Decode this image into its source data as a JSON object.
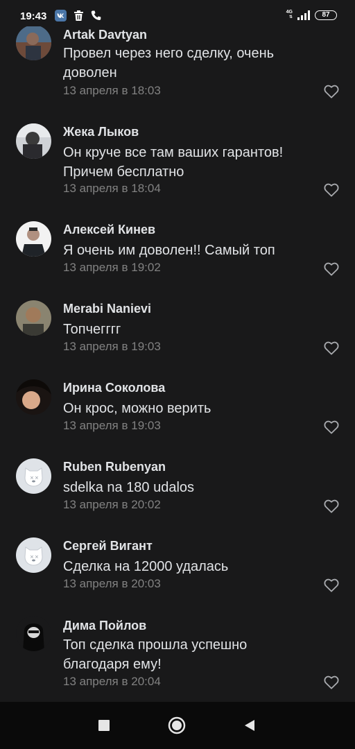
{
  "status_bar": {
    "time": "19:43",
    "network": "4G",
    "battery": "87"
  },
  "comments": [
    {
      "author": "Artak Davtyan",
      "text": "Провел через него сделку, очень доволен",
      "date": "13 апреля в 18:03",
      "avatar": "photo"
    },
    {
      "author": "Жека Лыков",
      "text": "Он круче все там ваших гарантов! Причем бесплатно",
      "date": "13 апреля в 18:04",
      "avatar": "photo"
    },
    {
      "author": "Алексей Кинев",
      "text": "Я очень им доволен!! Самый топ",
      "date": "13 апреля в 19:02",
      "avatar": "photo"
    },
    {
      "author": "Merabi Nanievi",
      "text": "Топчегггг",
      "date": "13 апреля в 19:03",
      "avatar": "photo"
    },
    {
      "author": "Ирина Соколова",
      "text": "Он крос, можно верить",
      "date": "13 апреля в 19:03",
      "avatar": "photo"
    },
    {
      "author": "Ruben Rubenyan",
      "text": "sdelka na 180 udalos",
      "date": "13 апреля в 20:02",
      "avatar": "default-dog-icon"
    },
    {
      "author": "Сергей Вигант",
      "text": "Сделка на 12000 удалась",
      "date": "13 апреля в 20:03",
      "avatar": "default-dog-icon"
    },
    {
      "author": "Дима Пойлов",
      "text": "Топ сделка прошла успешно благодаря ему!",
      "date": "13 апреля в 20:04",
      "avatar": "photo"
    }
  ],
  "colors": {
    "background": "#19191a",
    "text": "#e1e3e6",
    "secondary": "#828282",
    "navbar": "#0a0a0a"
  },
  "icons": {
    "like": "heart-outline-icon",
    "nav": [
      "square-recents-icon",
      "circle-home-icon",
      "triangle-back-icon"
    ]
  }
}
